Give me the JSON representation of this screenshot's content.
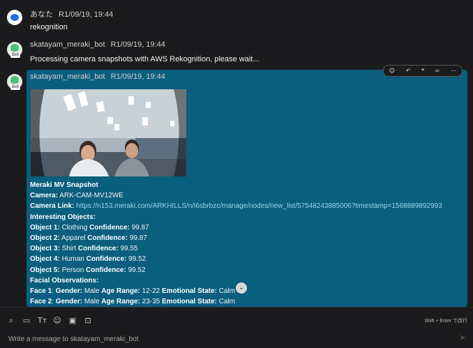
{
  "messages": [
    {
      "author": "あなた",
      "time": "R1/09/19, 19:44",
      "text": "rekognition"
    },
    {
      "author": "skatayam_meraki_bot",
      "time": "R1/09/19, 19:44",
      "text": "Processing camera snapshots with AWS Rekognition, please wait..."
    },
    {
      "author": "skatayam_meraki_bot",
      "time": "R1/09/19, 19:44"
    }
  ],
  "bot_badge": "Bot",
  "toolbar": {
    "icons": [
      "emoji-reaction-icon",
      "reply-icon",
      "quote-icon",
      "forward-icon",
      "more-icon"
    ]
  },
  "snapshot_card": {
    "title": "Meraki MV Snapshot",
    "camera_label": "Camera:",
    "camera_value": "ARK-CAM-MV12WE",
    "link_label": "Camera Link:",
    "link_value": "https://n153.meraki.com/ARKHILLS/n/i6sbrbzc/manage/nodes/new_list/57548243885006?timestamp=1568889892993",
    "objects_heading": "Interesting Objects:",
    "confidence_label": "Confidence:",
    "objects": [
      {
        "label": "Object 1:",
        "name": "Clothing",
        "confidence": "99.87"
      },
      {
        "label": "Object 2:",
        "name": "Apparel",
        "confidence": "99.87"
      },
      {
        "label": "Object 3:",
        "name": "Shirt",
        "confidence": "99.55"
      },
      {
        "label": "Object 4:",
        "name": "Human",
        "confidence": "99.52"
      },
      {
        "label": "Object 5:",
        "name": "Person",
        "confidence": "99.52"
      }
    ],
    "faces_heading": "Facial Observations:",
    "gender_label": "Gender:",
    "age_label": "Age Range:",
    "emotion_label": "Emotional State:",
    "faces": [
      {
        "label": "Face 1",
        "gender": "Male",
        "age": "12-22",
        "emotion": "Calm"
      },
      {
        "label": "Face 2",
        "gender": "Male",
        "age": "23-35",
        "emotion": "Calm"
      }
    ]
  },
  "composer": {
    "placeholder": "Write a message to skatayam_meraki_bot",
    "hint": "Shift + Enter で改行",
    "icons": [
      "attach-icon",
      "canvas-icon",
      "text-format-icon",
      "emoji-icon",
      "gif-icon",
      "whiteboard-icon"
    ]
  }
}
